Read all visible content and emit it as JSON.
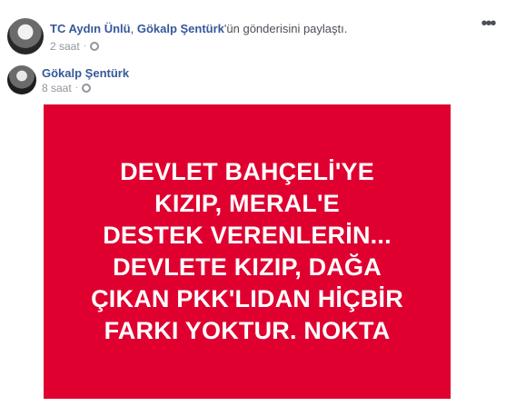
{
  "post": {
    "header": {
      "author": "TC Aydın Ünlü",
      "middle": ", ",
      "shared_from": "Gökalp Şentürk",
      "suffix": "'ün gönderisini paylaştı.",
      "time": "2 saat",
      "dot": "·",
      "more": "•••"
    },
    "original": {
      "author": "Gökalp Şentürk",
      "time": "8 saat",
      "dot": "·"
    },
    "image": {
      "background_color": "#df0030",
      "text_color": "#ffffff",
      "text": "DEVLET BAHÇELİ'YE\nKIZIP, MERAL'E\nDESTEK VERENLERİN...\nDEVLETE KIZIP, DAĞA\nÇIKAN PKK'LIDAN HİÇBİR\nFARKI YOKTUR. NOKTA"
    }
  }
}
